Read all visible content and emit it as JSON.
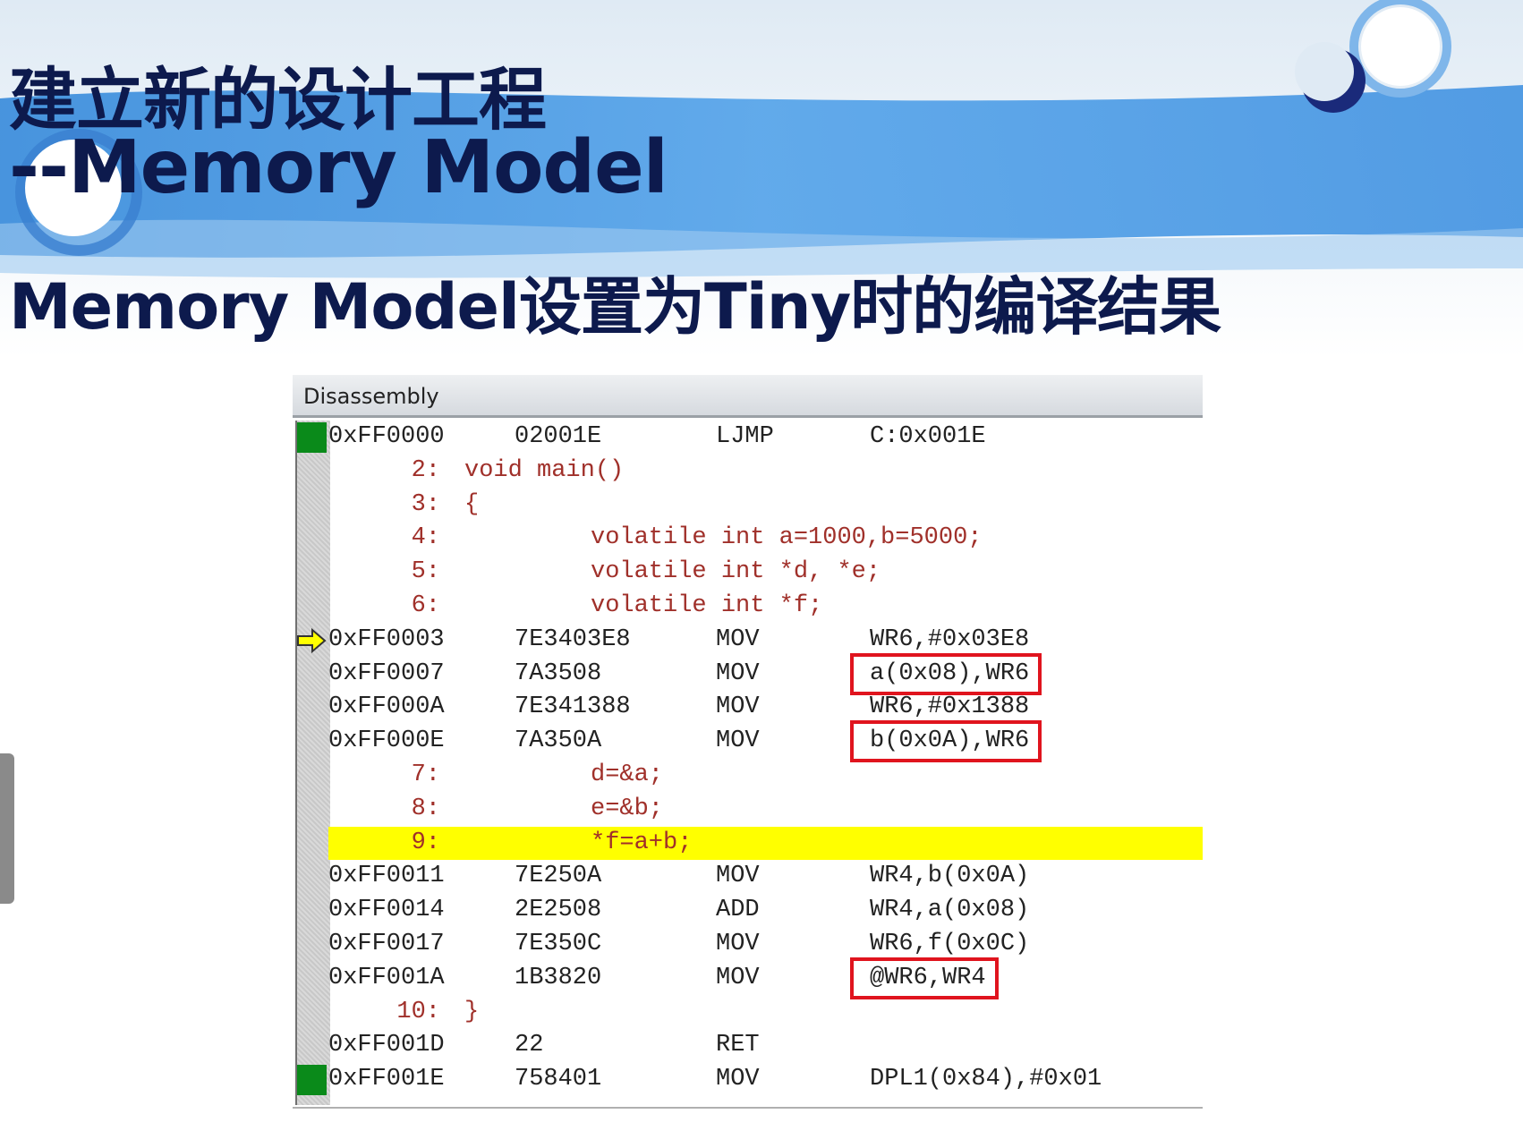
{
  "slide": {
    "title_line1": "建立新的设计工程",
    "title_line2": "--Memory Model",
    "subtitle": "Memory Model设置为Tiny时的编译结果"
  },
  "window": {
    "title": "Disassembly"
  },
  "rows": [
    {
      "kind": "asm",
      "addr": "0xFF0000",
      "bytes": "02001E",
      "mnem": "LJMP",
      "oper": "C:0x001E",
      "marker": "green"
    },
    {
      "kind": "src",
      "num": "2:",
      "text": "void main()",
      "indent": 0
    },
    {
      "kind": "src",
      "num": "3:",
      "text": "{",
      "indent": 0
    },
    {
      "kind": "src",
      "num": "4:",
      "text": "volatile int a=1000,b=5000;",
      "indent": 1
    },
    {
      "kind": "src",
      "num": "5:",
      "text": "volatile int *d, *e;",
      "indent": 1
    },
    {
      "kind": "src",
      "num": "6:",
      "text": "volatile int *f;",
      "indent": 1
    },
    {
      "kind": "asm",
      "addr": "0xFF0003",
      "bytes": "7E3403E8",
      "mnem": "MOV",
      "oper": "WR6,#0x03E8",
      "marker": "arrow"
    },
    {
      "kind": "asm",
      "addr": "0xFF0007",
      "bytes": "7A3508",
      "mnem": "MOV",
      "oper": "a(0x08),WR6",
      "boxed": true
    },
    {
      "kind": "asm",
      "addr": "0xFF000A",
      "bytes": "7E341388",
      "mnem": "MOV",
      "oper": "WR6,#0x1388"
    },
    {
      "kind": "asm",
      "addr": "0xFF000E",
      "bytes": "7A350A",
      "mnem": "MOV",
      "oper": "b(0x0A),WR6",
      "boxed": true
    },
    {
      "kind": "src",
      "num": "7:",
      "text": "d=&a;",
      "indent": 1
    },
    {
      "kind": "src",
      "num": "8:",
      "text": "e=&b;",
      "indent": 1
    },
    {
      "kind": "src",
      "num": "9:",
      "text": "*f=a+b;",
      "indent": 1,
      "highlight": true
    },
    {
      "kind": "asm",
      "addr": "0xFF0011",
      "bytes": "7E250A",
      "mnem": "MOV",
      "oper": "WR4,b(0x0A)"
    },
    {
      "kind": "asm",
      "addr": "0xFF0014",
      "bytes": "2E2508",
      "mnem": "ADD",
      "oper": "WR4,a(0x08)"
    },
    {
      "kind": "asm",
      "addr": "0xFF0017",
      "bytes": "7E350C",
      "mnem": "MOV",
      "oper": "WR6,f(0x0C)"
    },
    {
      "kind": "asm",
      "addr": "0xFF001A",
      "bytes": "1B3820",
      "mnem": "MOV",
      "oper": "@WR6,WR4",
      "boxed": true
    },
    {
      "kind": "src",
      "num": "10:",
      "text": "}",
      "indent": 0
    },
    {
      "kind": "asm",
      "addr": "0xFF001D",
      "bytes": "22",
      "mnem": "RET",
      "oper": ""
    },
    {
      "kind": "asm",
      "addr": "0xFF001E",
      "bytes": "758401",
      "mnem": "MOV",
      "oper": "DPL1(0x84),#0x01",
      "marker": "green"
    }
  ],
  "colors": {
    "title": "#0d1a4d",
    "banner": "#4f9ee6",
    "highlight": "#ffff00",
    "box": "#e0141e",
    "source": "#a0302a"
  }
}
